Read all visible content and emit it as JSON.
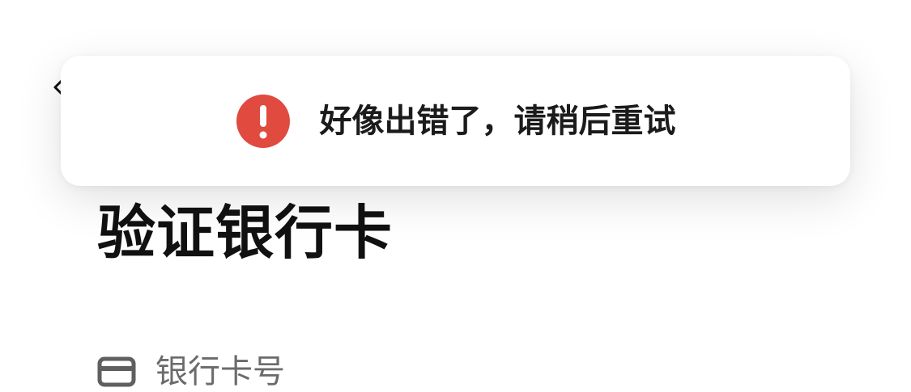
{
  "page": {
    "title": "验证银行卡",
    "field": {
      "icon": "credit-card-icon",
      "label": "银行卡号"
    }
  },
  "toast": {
    "icon": "error-exclamation-icon",
    "message": "好像出错了，请稍后重试",
    "icon_color": "#E04A3F"
  },
  "colors": {
    "title": "#111111",
    "label": "#6B6B6B",
    "icon_gray": "#5F5F5F"
  }
}
